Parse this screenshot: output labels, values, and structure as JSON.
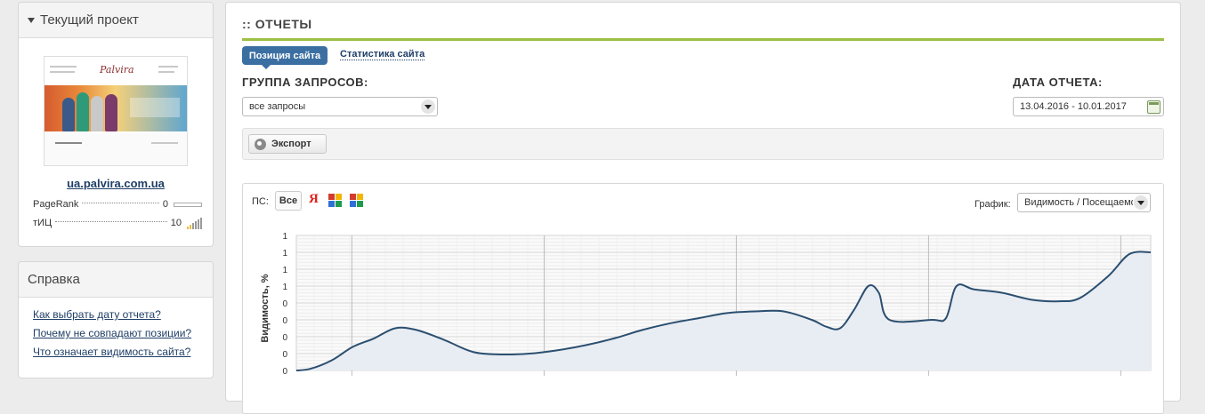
{
  "sidebar": {
    "project": {
      "title": "Текущий проект",
      "thumbnail_logo": "Palvira",
      "site_link": "ua.palvira.com.ua",
      "metrics": [
        {
          "name": "PageRank",
          "value": "0"
        },
        {
          "name": "тИЦ",
          "value": "10"
        }
      ]
    },
    "help": {
      "title": "Справка",
      "links": [
        "Как выбрать дату отчета?",
        "Почему не совпадают позиции?",
        "Что означает видимость сайта?"
      ]
    }
  },
  "main": {
    "title": ":: ОТЧЕТЫ",
    "tabs": [
      {
        "label": "Позиция сайта",
        "active": true
      },
      {
        "label": "Статистика сайта",
        "active": false
      }
    ],
    "query_group": {
      "label": "ГРУППА ЗАПРОСОВ:",
      "value": "все запросы"
    },
    "report_date": {
      "label": "ДАТА ОТЧЕТА:",
      "value": "13.04.2016 - 10.01.2017"
    },
    "export_label": "Экспорт",
    "search_engines": {
      "label": "ПС:",
      "all_label": "Все",
      "yandex_glyph": "Я"
    },
    "graph_select": {
      "label": "График:",
      "value": "Видимость / Посещаемо"
    }
  },
  "colors": {
    "accent": "#9cc043",
    "tab": "#3b6fa2",
    "link": "#1f3e66",
    "line": "#2b4f70"
  },
  "icons": [
    "dropdown-arrow-icon",
    "calendar-icon",
    "export-icon",
    "yandex-icon",
    "google-icon"
  ],
  "chart_data": {
    "type": "line",
    "ylabel": "Видимость, %",
    "yticks": [
      "0",
      "0",
      "0",
      "0",
      "0",
      "1",
      "1",
      "1",
      "1"
    ],
    "ylim": [
      0,
      8
    ],
    "grid": true,
    "series": [
      {
        "values": [
          [
            0,
            0.0
          ],
          [
            2,
            0.1
          ],
          [
            5,
            0.6
          ],
          [
            8,
            1.4
          ],
          [
            11,
            1.9
          ],
          [
            14,
            2.5
          ],
          [
            17,
            2.4
          ],
          [
            21,
            1.8
          ],
          [
            25,
            1.1
          ],
          [
            29,
            0.95
          ],
          [
            33,
            1.0
          ],
          [
            37,
            1.2
          ],
          [
            41,
            1.5
          ],
          [
            45,
            1.9
          ],
          [
            49,
            2.4
          ],
          [
            53,
            2.8
          ],
          [
            57,
            3.1
          ],
          [
            61,
            3.4
          ],
          [
            65,
            3.5
          ],
          [
            69,
            3.5
          ],
          [
            73,
            3.0
          ],
          [
            75,
            2.6
          ],
          [
            77,
            2.5
          ],
          [
            79,
            3.6
          ],
          [
            81,
            5.0
          ],
          [
            82.5,
            4.6
          ],
          [
            84,
            3.0
          ],
          [
            90,
            3.0
          ],
          [
            92,
            3.1
          ],
          [
            93.5,
            5.0
          ],
          [
            96,
            4.8
          ],
          [
            100,
            4.6
          ],
          [
            104,
            4.2
          ],
          [
            108,
            4.1
          ],
          [
            111,
            4.3
          ],
          [
            115,
            5.6
          ],
          [
            118,
            6.9
          ],
          [
            121,
            7.0
          ]
        ]
      }
    ]
  }
}
